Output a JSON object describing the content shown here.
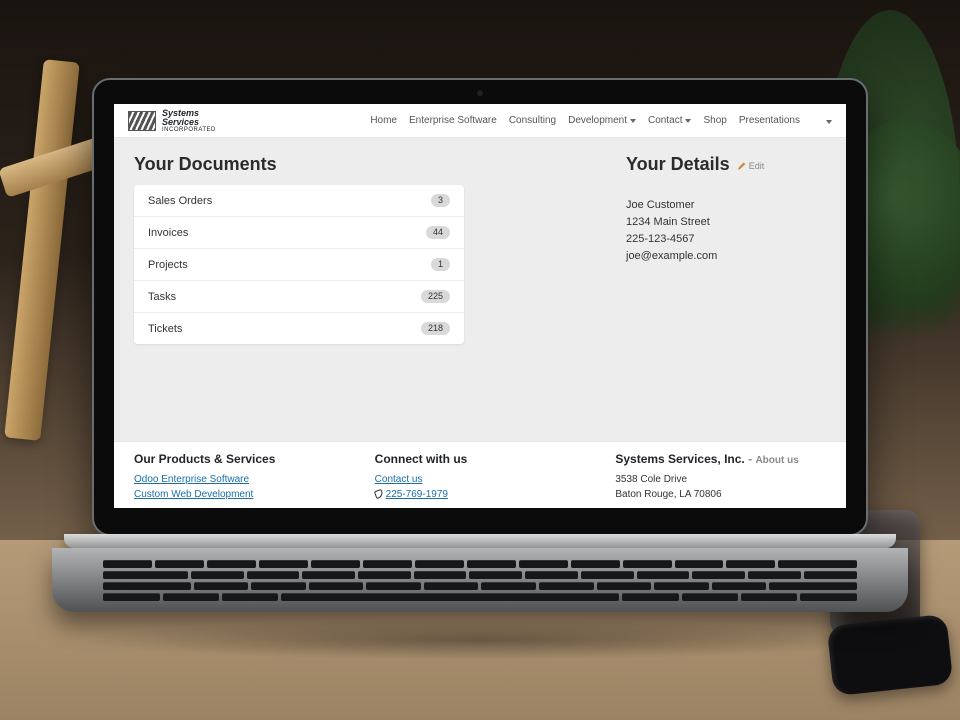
{
  "brand": {
    "line1": "Systems",
    "line2": "Services",
    "line3": "INCORPORATED"
  },
  "nav": {
    "home": "Home",
    "enterprise": "Enterprise Software",
    "consulting": "Consulting",
    "development": "Development",
    "contact": "Contact",
    "shop": "Shop",
    "presentations": "Presentations"
  },
  "documents": {
    "heading": "Your Documents",
    "items": [
      {
        "label": "Sales Orders",
        "count": "3"
      },
      {
        "label": "Invoices",
        "count": "44"
      },
      {
        "label": "Projects",
        "count": "1"
      },
      {
        "label": "Tasks",
        "count": "225"
      },
      {
        "label": "Tickets",
        "count": "218"
      }
    ]
  },
  "details": {
    "heading": "Your Details",
    "edit": "Edit",
    "name": "Joe Customer",
    "address": "1234 Main Street",
    "phone": "225-123-4567",
    "email": "joe@example.com"
  },
  "footer": {
    "col1": {
      "heading": "Our Products & Services",
      "line1": "Odoo Enterprise Software",
      "line2": "Custom Web Development"
    },
    "col2": {
      "heading": "Connect with us",
      "contact": "Contact us",
      "phone": "225-769-1979"
    },
    "col3": {
      "heading": "Systems Services, Inc.",
      "sep": " - ",
      "about": "About us",
      "addr1": "3538 Cole Drive",
      "addr2": "Baton Rouge, LA 70806"
    }
  }
}
